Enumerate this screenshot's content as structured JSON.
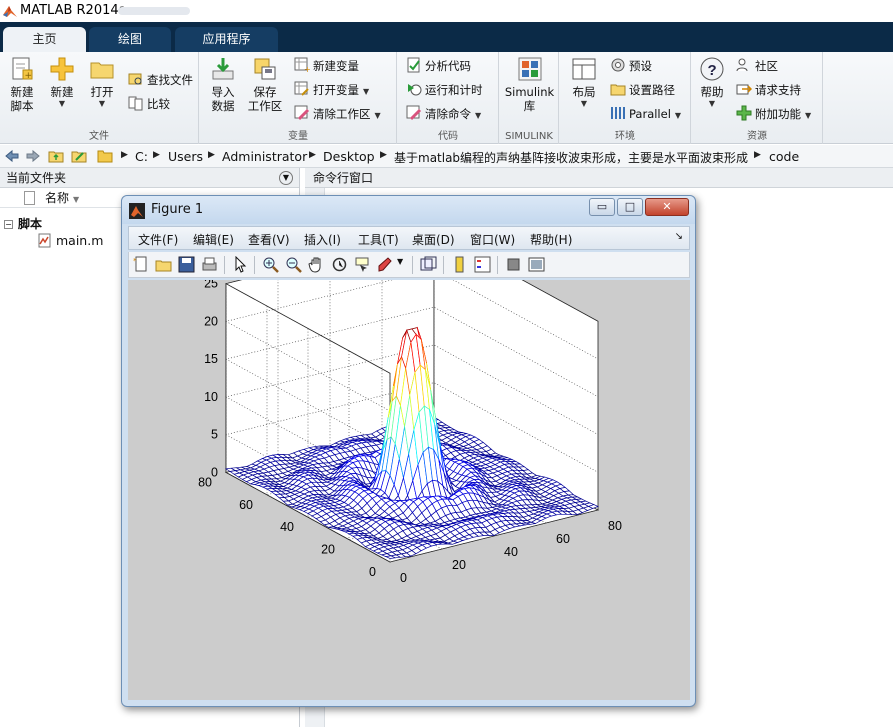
{
  "app": {
    "title": "MATLAB R2014a"
  },
  "tabs": [
    {
      "label": "主页",
      "active": true
    },
    {
      "label": "绘图",
      "active": false
    },
    {
      "label": "应用程序",
      "active": false
    }
  ],
  "ribbon": {
    "file": {
      "label": "文件",
      "new_script": "新建\n脚本",
      "new": "新建",
      "open": "打开",
      "find_files": "查找文件",
      "compare": "比较"
    },
    "variable": {
      "label": "变量",
      "import_data": "导入\n数据",
      "save_workspace": "保存\n工作区",
      "new_variable": "新建变量",
      "open_variable": "打开变量",
      "clear_workspace": "清除工作区"
    },
    "code": {
      "label": "代码",
      "analyze_code": "分析代码",
      "run_and_time": "运行和计时",
      "clear_commands": "清除命令"
    },
    "simulink": {
      "label": "SIMULINK",
      "simulink_library": "Simulink\n库"
    },
    "environment": {
      "label": "环境",
      "layout": "布局",
      "preferences": "预设",
      "set_path": "设置路径",
      "parallel": "Parallel"
    },
    "resources": {
      "label": "资源",
      "help": "帮助",
      "community": "社区",
      "request_support": "请求支持",
      "add_ons": "附加功能"
    }
  },
  "address": {
    "crumbs": [
      "C:",
      "Users",
      "Administrator",
      "Desktop",
      "基于matlab编程的声纳基阵接收波束形成，主要是水平面波束形成",
      "code"
    ]
  },
  "current_folder": {
    "title": "当前文件夹",
    "column_name": "名称",
    "group": "脚本",
    "files": [
      "main.m"
    ]
  },
  "command_window": {
    "title": "命令行窗口"
  },
  "figure": {
    "title": "Figure 1",
    "menus": [
      "文件(F)",
      "编辑(E)",
      "查看(V)",
      "插入(I)",
      "工具(T)",
      "桌面(D)",
      "窗口(W)",
      "帮助(H)"
    ],
    "window_buttons": {
      "minimize": "▭",
      "maximize": "□",
      "close": "✕"
    }
  },
  "chart_data": {
    "type": "surface",
    "title": "",
    "xlabel": "",
    "ylabel": "",
    "zlabel": "",
    "xlim": [
      0,
      80
    ],
    "ylim": [
      0,
      80
    ],
    "zlim": [
      0,
      25
    ],
    "x_ticks": [
      0,
      20,
      40,
      60,
      80
    ],
    "y_ticks": [
      0,
      20,
      40,
      60,
      80
    ],
    "z_ticks": [
      0,
      5,
      10,
      15,
      20,
      25
    ],
    "grid": true,
    "colormap": "jet",
    "peak": {
      "x": 40,
      "y": 40,
      "z": 21.5
    },
    "grid_size": 40
  }
}
